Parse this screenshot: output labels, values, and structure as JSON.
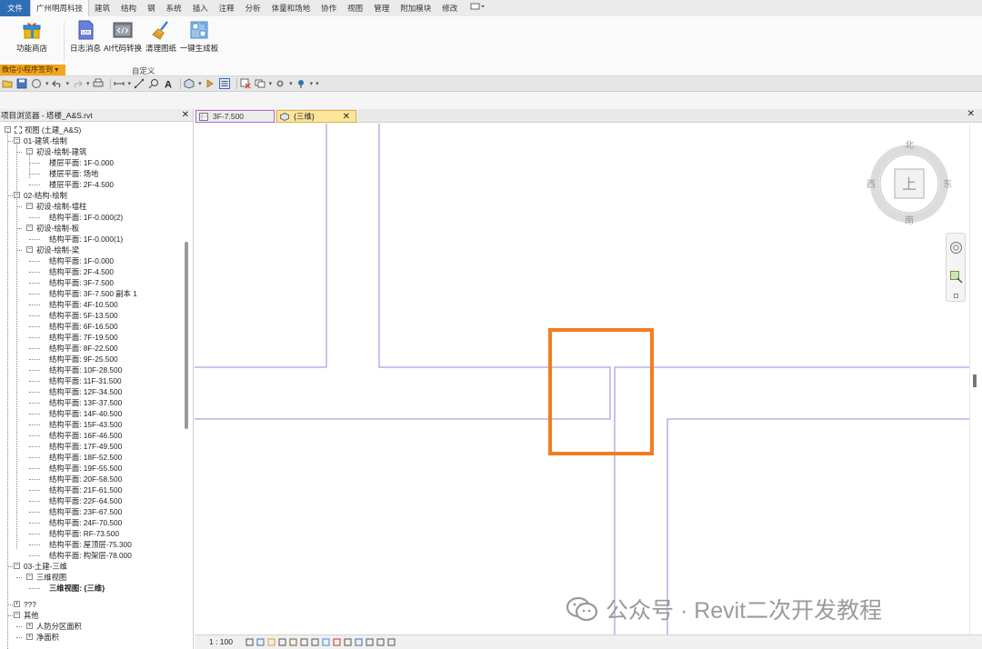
{
  "ribbon_tabs": [
    {
      "label": "文件",
      "kind": "file"
    },
    {
      "label": "广州明周科技",
      "kind": "active"
    },
    {
      "label": "建筑",
      "kind": "normal"
    },
    {
      "label": "结构",
      "kind": "normal"
    },
    {
      "label": "钢",
      "kind": "normal"
    },
    {
      "label": "系统",
      "kind": "normal"
    },
    {
      "label": "插入",
      "kind": "normal"
    },
    {
      "label": "注释",
      "kind": "normal"
    },
    {
      "label": "分析",
      "kind": "normal"
    },
    {
      "label": "体量和场地",
      "kind": "normal"
    },
    {
      "label": "协作",
      "kind": "normal"
    },
    {
      "label": "视图",
      "kind": "normal"
    },
    {
      "label": "管理",
      "kind": "normal"
    },
    {
      "label": "附加模块",
      "kind": "normal"
    },
    {
      "label": "修改",
      "kind": "normal"
    }
  ],
  "ribbon": {
    "store_label": "功能商店",
    "log_label": "日志消息",
    "ai_label": "AI代码转换",
    "clean_label": "清理图纸",
    "gen_label": "一键生成板",
    "panel_label": "自定义",
    "strip_label": "微信小程序签到"
  },
  "browser": {
    "title": "项目浏览器 - 塔楼_A&S.rvt",
    "close": "✕",
    "nodes": [
      {
        "label": "视图 (土建_A&S)",
        "level": 0,
        "exp": "−",
        "icon": true
      },
      {
        "label": "01-建筑-绘制",
        "level": 1,
        "exp": "−"
      },
      {
        "label": "初设-绘制-建筑",
        "level": 2,
        "exp": "−"
      },
      {
        "label": "楼层平面: 1F-0.000",
        "level": 3
      },
      {
        "label": "楼层平面: 场地",
        "level": 3
      },
      {
        "label": "楼层平面: 2F-4.500",
        "level": 3
      },
      {
        "label": "02-结构-绘制",
        "level": 1,
        "exp": "−"
      },
      {
        "label": "初设-绘制-墙柱",
        "level": 2,
        "exp": "−"
      },
      {
        "label": "结构平面: 1F-0.000(2)",
        "level": 3
      },
      {
        "label": "初设-绘制-板",
        "level": 2,
        "exp": "−"
      },
      {
        "label": "结构平面: 1F-0.000(1)",
        "level": 3
      },
      {
        "label": "初设-绘制-梁",
        "level": 2,
        "exp": "−"
      },
      {
        "label": "结构平面: 1F-0.000",
        "level": 3
      },
      {
        "label": "结构平面: 2F-4.500",
        "level": 3
      },
      {
        "label": "结构平面: 3F-7.500",
        "level": 3
      },
      {
        "label": "结构平面: 3F-7.500 副本 1",
        "level": 3
      },
      {
        "label": "结构平面: 4F-10.500",
        "level": 3
      },
      {
        "label": "结构平面: 5F-13.500",
        "level": 3
      },
      {
        "label": "结构平面: 6F-16.500",
        "level": 3
      },
      {
        "label": "结构平面: 7F-19.500",
        "level": 3
      },
      {
        "label": "结构平面: 8F-22.500",
        "level": 3
      },
      {
        "label": "结构平面: 9F-25.500",
        "level": 3
      },
      {
        "label": "结构平面: 10F-28.500",
        "level": 3
      },
      {
        "label": "结构平面: 11F-31.500",
        "level": 3
      },
      {
        "label": "结构平面: 12F-34.500",
        "level": 3
      },
      {
        "label": "结构平面: 13F-37.500",
        "level": 3
      },
      {
        "label": "结构平面: 14F-40.500",
        "level": 3
      },
      {
        "label": "结构平面: 15F-43.500",
        "level": 3
      },
      {
        "label": "结构平面: 16F-46.500",
        "level": 3
      },
      {
        "label": "结构平面: 17F-49.500",
        "level": 3
      },
      {
        "label": "结构平面: 18F-52.500",
        "level": 3
      },
      {
        "label": "结构平面: 19F-55.500",
        "level": 3
      },
      {
        "label": "结构平面: 20F-58.500",
        "level": 3
      },
      {
        "label": "结构平面: 21F-61.500",
        "level": 3
      },
      {
        "label": "结构平面: 22F-64.500",
        "level": 3
      },
      {
        "label": "结构平面: 23F-67.500",
        "level": 3
      },
      {
        "label": "结构平面: 24F-70.500",
        "level": 3
      },
      {
        "label": "结构平面: RF-73.500",
        "level": 3
      },
      {
        "label": "结构平面: 屋顶层-75.300",
        "level": 3
      },
      {
        "label": "结构平面: 构架层-78.000",
        "level": 3
      },
      {
        "label": "03-土建-三维",
        "level": 1,
        "exp": "−"
      },
      {
        "label": "三维视图",
        "level": 2,
        "exp": "−"
      },
      {
        "label": "三维视图: {三维}",
        "level": 3,
        "bold": true
      },
      {
        "label": "???",
        "level": 1,
        "exp": "+",
        "gap": true
      },
      {
        "label": "其他",
        "level": 1,
        "exp": "−"
      },
      {
        "label": "人防分区面积",
        "level": 2,
        "exp": "+"
      },
      {
        "label": "净面积",
        "level": 2,
        "exp": "+"
      }
    ]
  },
  "view_tabs": {
    "tab1": "3F-7.500",
    "tab2": "{三维}",
    "close": "✕",
    "right_close": "✕"
  },
  "viewcube": {
    "north": "北",
    "south": "南",
    "east": "东",
    "west": "西",
    "face": "上"
  },
  "status": {
    "scale": "1 : 100"
  },
  "watermark": {
    "text": "公众号 · Revit二次开发教程"
  },
  "colors": {
    "file_tab": "#2f6db5",
    "highlight_box": "#f57c1f",
    "model_lines": "#8d88e0",
    "active_view_tab": "#fde59a",
    "strip": "#f4a51c"
  }
}
